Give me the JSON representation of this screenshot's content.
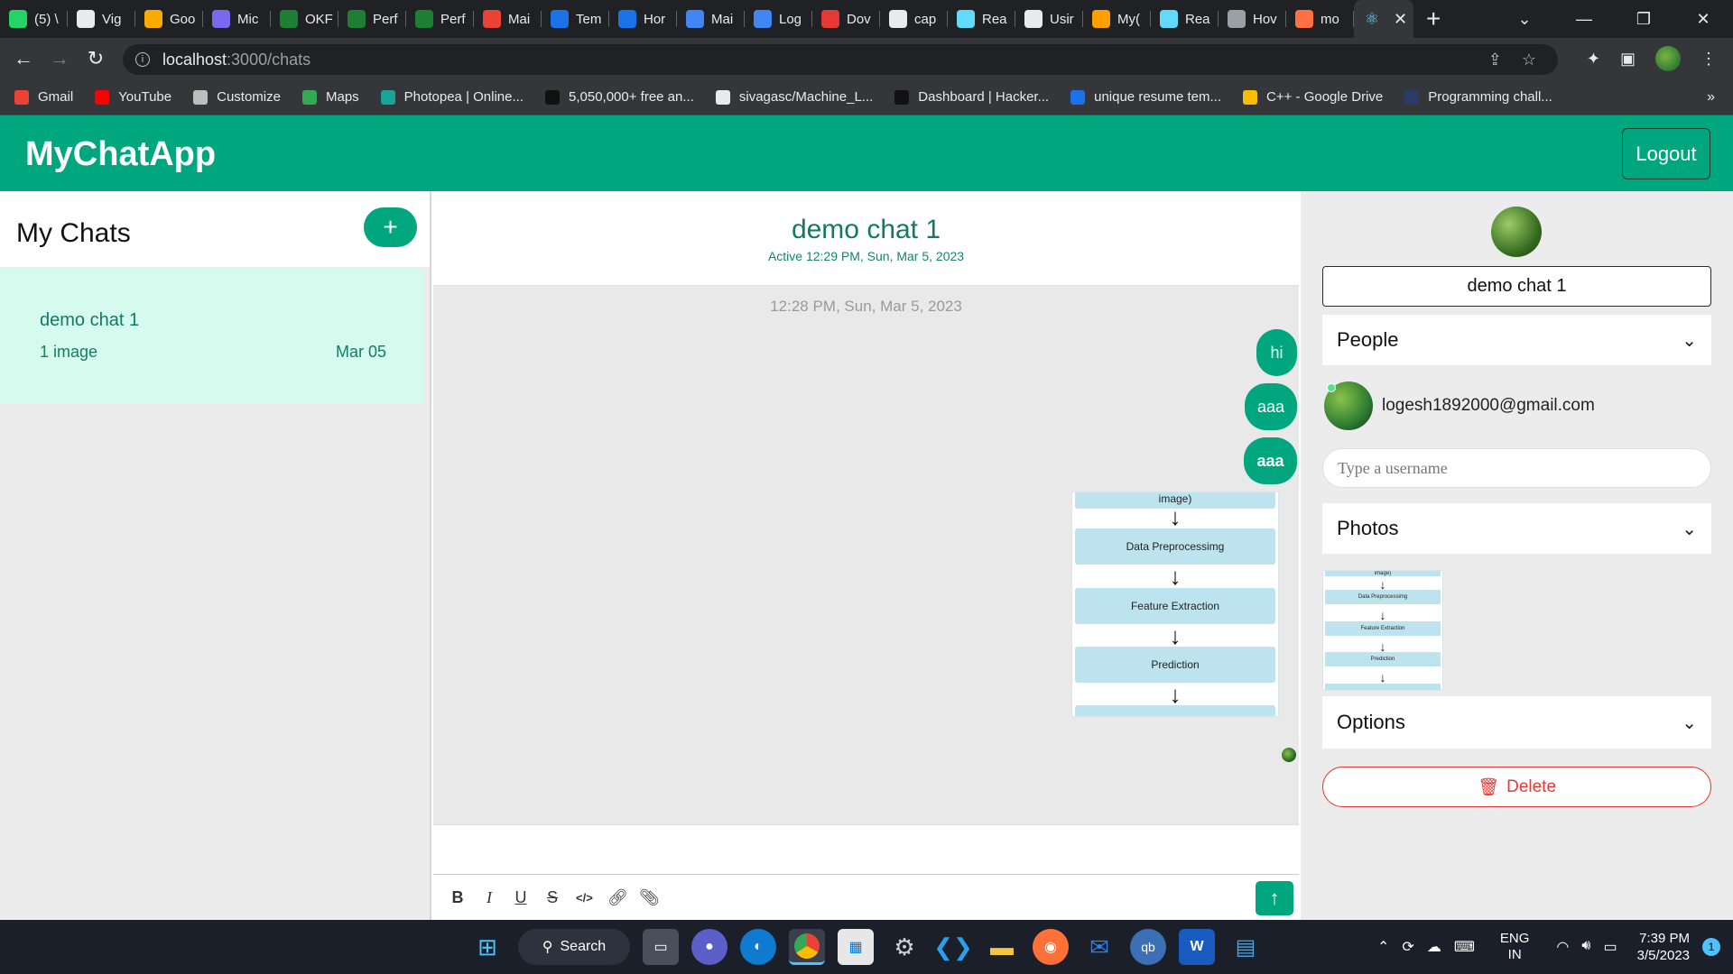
{
  "browser": {
    "tabs": [
      {
        "label": "(5) \\",
        "color": "#25d366"
      },
      {
        "label": "Vig",
        "color": "#e8eaed"
      },
      {
        "label": "Goo",
        "color": "#f9ab00"
      },
      {
        "label": "Mic",
        "color": "#7b68ee"
      },
      {
        "label": "OKF",
        "color": "#1e7e34"
      },
      {
        "label": "Perf",
        "color": "#1e7e34"
      },
      {
        "label": "Perf",
        "color": "#1e7e34"
      },
      {
        "label": "Mai",
        "color": "#ea4335"
      },
      {
        "label": "Tem",
        "color": "#1a73e8"
      },
      {
        "label": "Hor",
        "color": "#1a73e8"
      },
      {
        "label": "Mai",
        "color": "#4285f4"
      },
      {
        "label": "Log",
        "color": "#4285f4"
      },
      {
        "label": "Dov",
        "color": "#e53935"
      },
      {
        "label": "cap",
        "color": "#e8eaed"
      },
      {
        "label": "Rea",
        "color": "#61dafb"
      },
      {
        "label": "Usir",
        "color": "#e8eaed"
      },
      {
        "label": "My(",
        "color": "#ffa000"
      },
      {
        "label": "Rea",
        "color": "#61dafb"
      },
      {
        "label": "Hov",
        "color": "#9aa0a6"
      },
      {
        "label": "mo",
        "color": "#ff7043"
      }
    ],
    "active_tab_icon": "react-icon",
    "url_host": "localhost",
    "url_path": ":3000/chats",
    "bookmarks": [
      {
        "label": "Gmail",
        "color": "#ea4335"
      },
      {
        "label": "YouTube",
        "color": "#ff0000"
      },
      {
        "label": "Customize",
        "color": "#bdbdbd"
      },
      {
        "label": "Maps",
        "color": "#34a853"
      },
      {
        "label": "Photopea | Online...",
        "color": "#18a497"
      },
      {
        "label": "5,050,000+ free an...",
        "color": "#111111"
      },
      {
        "label": "sivagasc/Machine_L...",
        "color": "#e8eaed"
      },
      {
        "label": "Dashboard | Hacker...",
        "color": "#111111"
      },
      {
        "label": "unique resume tem...",
        "color": "#1a73e8"
      },
      {
        "label": "C++ - Google Drive",
        "color": "#fbbc04"
      },
      {
        "label": "Programming chall...",
        "color": "#2b3a67"
      }
    ],
    "bookmarks_more": "»"
  },
  "app": {
    "brand": "MyChatApp",
    "logout_label": "Logout",
    "accent": "#00a67e"
  },
  "chat_list": {
    "title": "My Chats",
    "add_label": "+",
    "items": [
      {
        "title": "demo chat 1",
        "subtitle": "1 image",
        "date": "Mar 05"
      }
    ]
  },
  "chat": {
    "title": "demo chat 1",
    "status": "Active 12:29 PM, Sun, Mar 5, 2023",
    "timestamp": "12:28 PM, Sun, Mar 5, 2023",
    "messages": [
      "hi",
      "aaa",
      "aaa"
    ],
    "image_flow": {
      "top_fragment": "image)",
      "steps": [
        "Data Preprocessimg",
        "Feature Extraction",
        "Prediction"
      ]
    },
    "composer_placeholder": "",
    "format_tools": [
      "B",
      "I",
      "U",
      "S",
      "</>",
      "link",
      "attach"
    ]
  },
  "settings": {
    "chat_name": "demo chat 1",
    "people_label": "People",
    "member_email": "logesh1892000@gmail.com",
    "username_placeholder": "Type a username",
    "photos_label": "Photos",
    "options_label": "Options",
    "delete_label": "Delete",
    "danger_color": "#e53935"
  },
  "taskbar": {
    "search_label": "Search",
    "lang_line1": "ENG",
    "lang_line2": "IN",
    "time": "7:39 PM",
    "date": "3/5/2023",
    "notification_count": "1"
  }
}
